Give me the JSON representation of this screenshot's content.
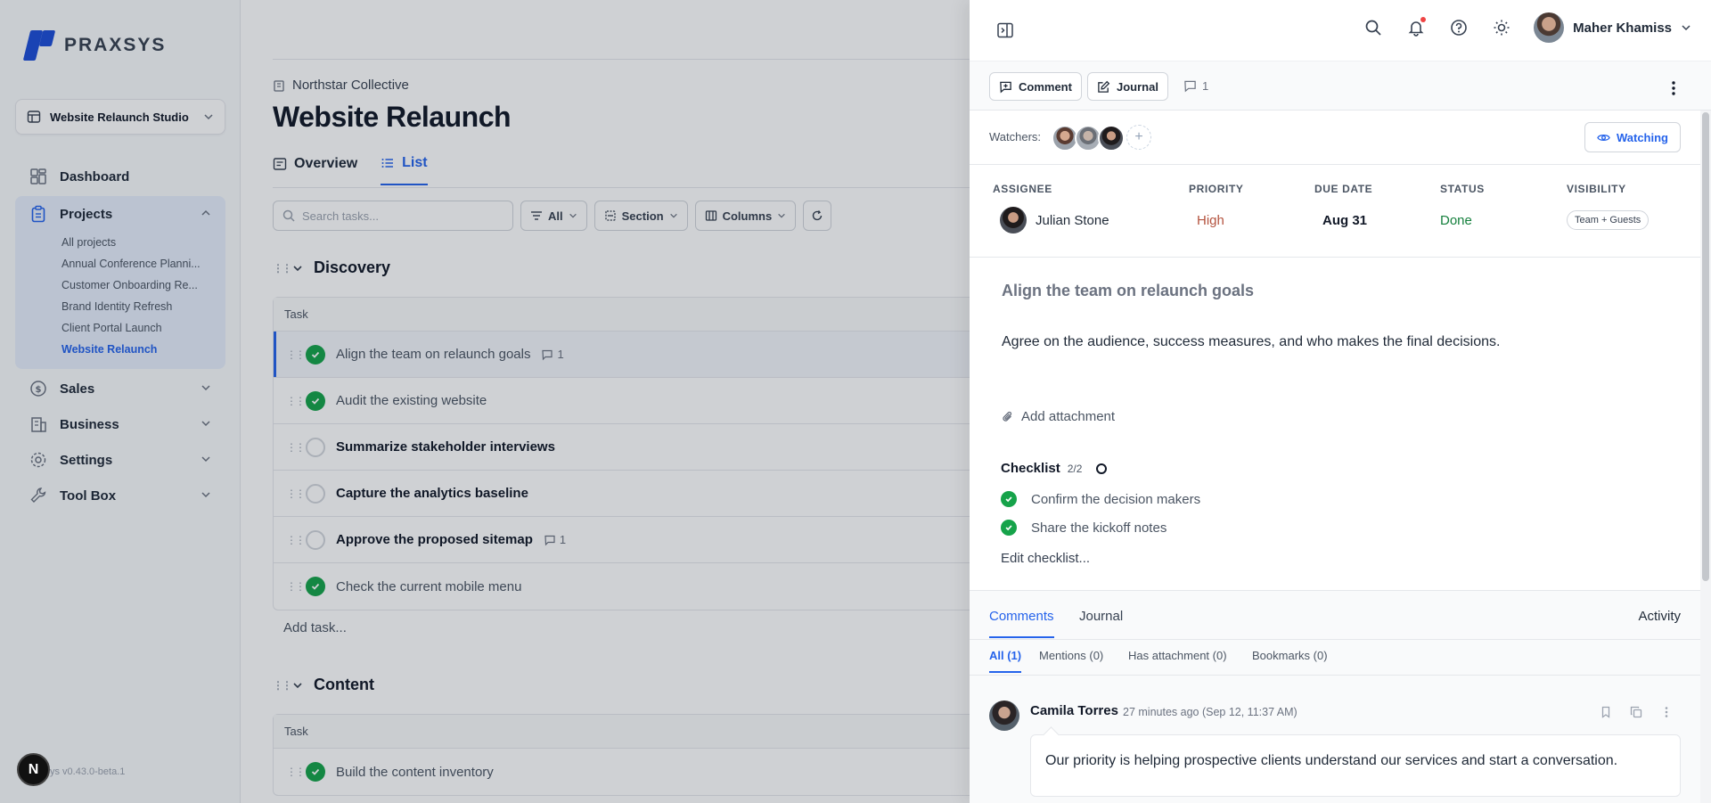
{
  "sidebar": {
    "logo_text": "PRAXSYS",
    "workspace": "Website Relaunch Studio",
    "nav": {
      "dashboard": "Dashboard",
      "projects": "Projects",
      "projects_sub": [
        "All projects",
        "Annual Conference Planni...",
        "Customer Onboarding Re...",
        "Brand Identity Refresh",
        "Client Portal Launch",
        "Website Relaunch"
      ],
      "sales": "Sales",
      "business": "Business",
      "settings": "Settings",
      "toolbox": "Tool Box"
    },
    "version": "ys v0.43.0-beta.1",
    "badge": "N"
  },
  "main": {
    "org": "Northstar Collective",
    "title": "Website Relaunch",
    "tabs": [
      "Overview",
      "List"
    ],
    "search_placeholder": "Search tasks...",
    "filters": [
      "All",
      "Section",
      "Columns"
    ],
    "sections": [
      {
        "name": "Discovery",
        "header": "Task",
        "tasks": [
          {
            "name": "Align the team on relaunch goals",
            "done": true,
            "comments": "1"
          },
          {
            "name": "Audit the existing website",
            "done": true
          },
          {
            "name": "Summarize stakeholder interviews",
            "done": false
          },
          {
            "name": "Capture the analytics baseline",
            "done": false
          },
          {
            "name": "Approve the proposed sitemap",
            "done": false,
            "comments": "1"
          },
          {
            "name": "Check the current mobile menu",
            "done": true
          }
        ],
        "add_task": "Add task..."
      },
      {
        "name": "Content",
        "header": "Task",
        "tasks": [
          {
            "name": "Build the content inventory",
            "done": true
          }
        ]
      }
    ]
  },
  "drawer": {
    "user_name": "Maher Khamiss",
    "actions": {
      "comment": "Comment",
      "journal": "Journal",
      "comment_count": "1"
    },
    "watchers_label": "Watchers:",
    "watch_button": "Watching",
    "meta": {
      "assignee_h": "ASSIGNEE",
      "assignee": "Julian Stone",
      "priority_h": "PRIORITY",
      "priority": "High",
      "due_h": "DUE DATE",
      "due": "Aug 31",
      "status_h": "STATUS",
      "status": "Done",
      "visibility_h": "VISIBILITY",
      "visibility": "Team + Guests"
    },
    "task_title": "Align the team on relaunch goals",
    "task_desc": "Agree on the audience, success measures, and who makes the final decisions.",
    "add_attachment": "Add attachment",
    "checklist": {
      "title": "Checklist",
      "count": "2/2",
      "items": [
        "Confirm the decision makers",
        "Share the kickoff notes"
      ],
      "edit": "Edit checklist..."
    },
    "comment_tabs": [
      "Comments",
      "Journal"
    ],
    "activity": "Activity",
    "filters": [
      "All (1)",
      "Mentions (0)",
      "Has attachment (0)",
      "Bookmarks (0)"
    ],
    "comment": {
      "author": "Camila Torres",
      "time": "27 minutes ago (Sep 12, 11:37 AM)",
      "text": "Our priority is helping prospective clients understand our services and start a conversation."
    }
  },
  "colors": {
    "accent": "#2563eb",
    "done": "#16a34a",
    "priority_high": "#b4533f",
    "status_done": "#15803d"
  }
}
